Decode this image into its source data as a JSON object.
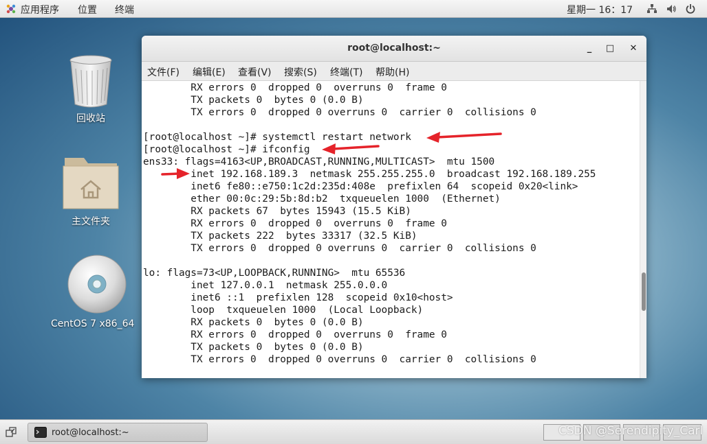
{
  "top_panel": {
    "applications": "应用程序",
    "places": "位置",
    "terminal": "终端",
    "clock": "星期一 16：17"
  },
  "desktop": {
    "trash_label": "回收站",
    "home_label": "主文件夹",
    "disc_label": "CentOS 7 x86_64"
  },
  "window": {
    "title": "root@localhost:~",
    "minimize": "_",
    "maximize": "□",
    "close": "✕",
    "menu": {
      "file": "文件(F)",
      "edit": "编辑(E)",
      "view": "查看(V)",
      "search": "搜索(S)",
      "terminal": "终端(T)",
      "help": "帮助(H)"
    }
  },
  "terminal": {
    "lines": [
      "        RX errors 0  dropped 0  overruns 0  frame 0",
      "        TX packets 0  bytes 0 (0.0 B)",
      "        TX errors 0  dropped 0 overruns 0  carrier 0  collisions 0",
      "",
      "[root@localhost ~]# systemctl restart network",
      "[root@localhost ~]# ifconfig",
      "ens33: flags=4163<UP,BROADCAST,RUNNING,MULTICAST>  mtu 1500",
      "        inet 192.168.189.3  netmask 255.255.255.0  broadcast 192.168.189.255",
      "        inet6 fe80::e750:1c2d:235d:408e  prefixlen 64  scopeid 0x20<link>",
      "        ether 00:0c:29:5b:8d:b2  txqueuelen 1000  (Ethernet)",
      "        RX packets 67  bytes 15943 (15.5 KiB)",
      "        RX errors 0  dropped 0  overruns 0  frame 0",
      "        TX packets 222  bytes 33317 (32.5 KiB)",
      "        TX errors 0  dropped 0 overruns 0  carrier 0  collisions 0",
      "",
      "lo: flags=73<UP,LOOPBACK,RUNNING>  mtu 65536",
      "        inet 127.0.0.1  netmask 255.0.0.0",
      "        inet6 ::1  prefixlen 128  scopeid 0x10<host>",
      "        loop  txqueuelen 1000  (Local Loopback)",
      "        RX packets 0  bytes 0 (0.0 B)",
      "        RX errors 0  dropped 0  overruns 0  frame 0",
      "        TX packets 0  bytes 0 (0.0 B)",
      "        TX errors 0  dropped 0 overruns 0  carrier 0  collisions 0"
    ]
  },
  "taskbar": {
    "task_label": "root@localhost:~"
  },
  "watermark": "CSDN @Serendipity_Carl",
  "colors": {
    "annotation_arrow": "#e5232a"
  }
}
